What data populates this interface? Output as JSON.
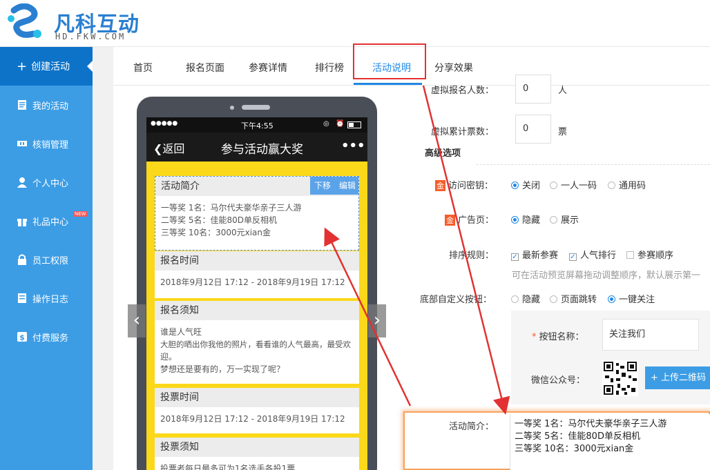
{
  "brand": {
    "name": "凡科互动",
    "sub": "HD.FKW.COM"
  },
  "sidebar": {
    "items": [
      {
        "label": "创建活动",
        "icon": "plus-icon"
      },
      {
        "label": "我的活动",
        "icon": "document-icon"
      },
      {
        "label": "核销管理",
        "icon": "ticket-icon"
      },
      {
        "label": "个人中心",
        "icon": "user-icon"
      },
      {
        "label": "礼品中心",
        "icon": "gift-icon",
        "badge": "NEW"
      },
      {
        "label": "员工权限",
        "icon": "lock-icon"
      },
      {
        "label": "操作日志",
        "icon": "log-icon"
      },
      {
        "label": "付费服务",
        "icon": "dollar-icon"
      }
    ]
  },
  "tabs": [
    "首页",
    "报名页面",
    "参赛详情",
    "排行榜",
    "活动说明",
    "分享效果"
  ],
  "phone": {
    "status_dots": "●●●●●",
    "status_time": "下午4:55",
    "back_label": "返回",
    "title": "参与活动赢大奖",
    "more": "•••",
    "edit_actions": {
      "move_down": "下移",
      "edit": "编辑"
    },
    "cards": [
      {
        "title": "活动简介",
        "lines": [
          "一等奖 1名：马尔代夫豪华亲子三人游",
          "二等奖 5名：佳能80D单反相机",
          "三等奖 10名：3000元xian金"
        ]
      },
      {
        "title": "报名时间",
        "lines": [
          "2018年9月12日 17:12 - 2018年9月19日 17:12"
        ]
      },
      {
        "title": "报名须知",
        "lines": [
          "谁是人气旺",
          "大胆的晒出你我他的照片，看看谁的人气最高，最受欢",
          "迎。",
          "梦想还是要有的，万一实现了呢？"
        ]
      },
      {
        "title": "投票时间",
        "lines": [
          "2018年9月12日 17:12 - 2018年9月19日 17:12"
        ]
      },
      {
        "title": "投票须知",
        "lines": [
          "投票者每日最多可为1名选手各投1票"
        ]
      }
    ]
  },
  "form": {
    "virtual_signup": {
      "label": "虚拟报名人数：",
      "value": "0",
      "unit": "人"
    },
    "virtual_votes": {
      "label": "虚拟累计票数：",
      "value": "0",
      "unit": "票"
    },
    "advanced_title": "高级选项",
    "gold_tag": "金",
    "access_key": {
      "label": "访问密钥：",
      "options": [
        "关闭",
        "一人一码",
        "通用码"
      ],
      "selected": 0
    },
    "ad_page": {
      "label": "广告页：",
      "options": [
        "隐藏",
        "展示"
      ],
      "selected": 0
    },
    "sort_rule": {
      "label": "排序规则：",
      "options": [
        "最新参赛",
        "人气排行",
        "参赛顺序"
      ],
      "checked": [
        true,
        true,
        false
      ],
      "hint": "可在活动预览屏幕拖动调整顺序，默认展示第一"
    },
    "bottom_button": {
      "label": "底部自定义按钮：",
      "options": [
        "隐藏",
        "页面跳转",
        "一键关注"
      ],
      "selected": 2
    },
    "button_name": {
      "label": "按钮名称：",
      "required_mark": "*",
      "value": "关注我们"
    },
    "wechat": {
      "label": "微信公众号：",
      "upload_label": "+ 上传二维码"
    },
    "intro": {
      "label": "活动简介：",
      "lines": [
        "一等奖 1名：马尔代夫豪华亲子三人游",
        "二等奖 5名：佳能80D单反相机",
        "三等奖 10名：3000元xian金"
      ]
    }
  },
  "colors": {
    "sidebar": "#3c9de5",
    "sidebar_active": "#0d73c9",
    "accent": "#1e88e5",
    "annotation": "#e23131",
    "phone_bg": "#fbd81a"
  }
}
